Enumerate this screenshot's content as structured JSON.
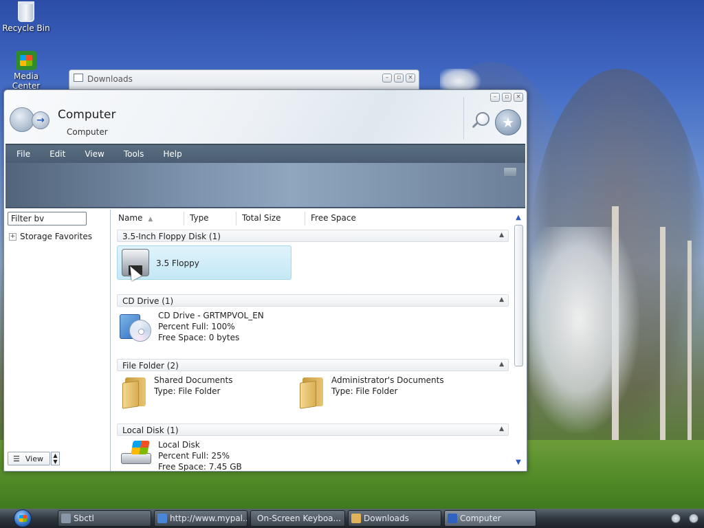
{
  "desktop": {
    "icons": [
      {
        "label": "Recycle Bin",
        "icon": "recycle-bin-icon"
      },
      {
        "label": "Media Center",
        "icon": "media-center-icon"
      }
    ]
  },
  "background_window": {
    "title": "Downloads"
  },
  "window": {
    "title": "Computer",
    "breadcrumb": "Computer",
    "menu": [
      "File",
      "Edit",
      "View",
      "Tools",
      "Help"
    ],
    "filter_value": "Filter bv",
    "tree": {
      "label": "Storage Favorites",
      "expander": "+"
    },
    "view_button": "View",
    "columns": [
      "Name",
      "Type",
      "Total Size",
      "Free Space"
    ],
    "groups": [
      {
        "header": "3.5-Inch Floppy Disk (1)",
        "items": [
          {
            "name": "3.5 Floppy",
            "icon": "floppy-disk-icon"
          }
        ]
      },
      {
        "header": "CD Drive (1)",
        "items": [
          {
            "name": "CD Drive - GRTMPVOL_EN",
            "line2": "Percent Full: 100%",
            "line3": "Free Space: 0 bytes",
            "icon": "cd-drive-icon"
          }
        ]
      },
      {
        "header": "File Folder (2)",
        "items": [
          {
            "name": "Shared Documents",
            "line2": "Type: File Folder",
            "icon": "folder-icon"
          },
          {
            "name": "Administrator's Documents",
            "line2": "Type: File Folder",
            "icon": "folder-icon"
          }
        ]
      },
      {
        "header": "Local Disk (1)",
        "items": [
          {
            "name": "Local Disk",
            "line2": "Percent Full: 25%",
            "line3": "Free Space: 7.45 GB",
            "icon": "local-disk-icon"
          }
        ]
      }
    ]
  },
  "taskbar": {
    "tasks": [
      {
        "label": "Sbctl"
      },
      {
        "label": "http://www.mypal..."
      },
      {
        "label": "On-Screen Keyboa..."
      },
      {
        "label": "Downloads"
      },
      {
        "label": "Computer"
      }
    ]
  }
}
